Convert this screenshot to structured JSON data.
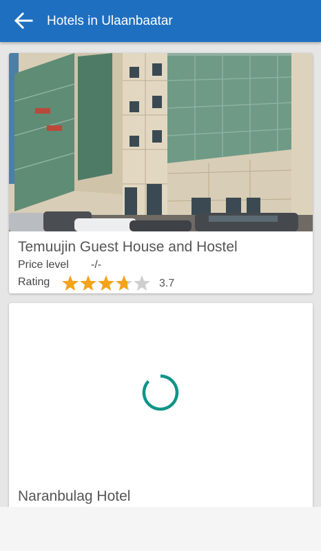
{
  "header": {
    "title": "Hotels in Ulaanbaatar",
    "back_icon": "arrow-left-icon"
  },
  "colors": {
    "app_bar": "#1e6fc0",
    "star_filled": "#f4a31b",
    "star_empty": "#cfcfcf",
    "spinner": "#0e9488"
  },
  "hotels": [
    {
      "name": "Temuujin Guest House and Hostel",
      "price_label": "Price level",
      "price_value": "-/-",
      "rating_label": "Rating",
      "rating": 3.7,
      "rating_text": "3.7",
      "image": "building-facade-photo"
    },
    {
      "name": "Naranbulag Hotel",
      "image_state": "loading"
    }
  ]
}
